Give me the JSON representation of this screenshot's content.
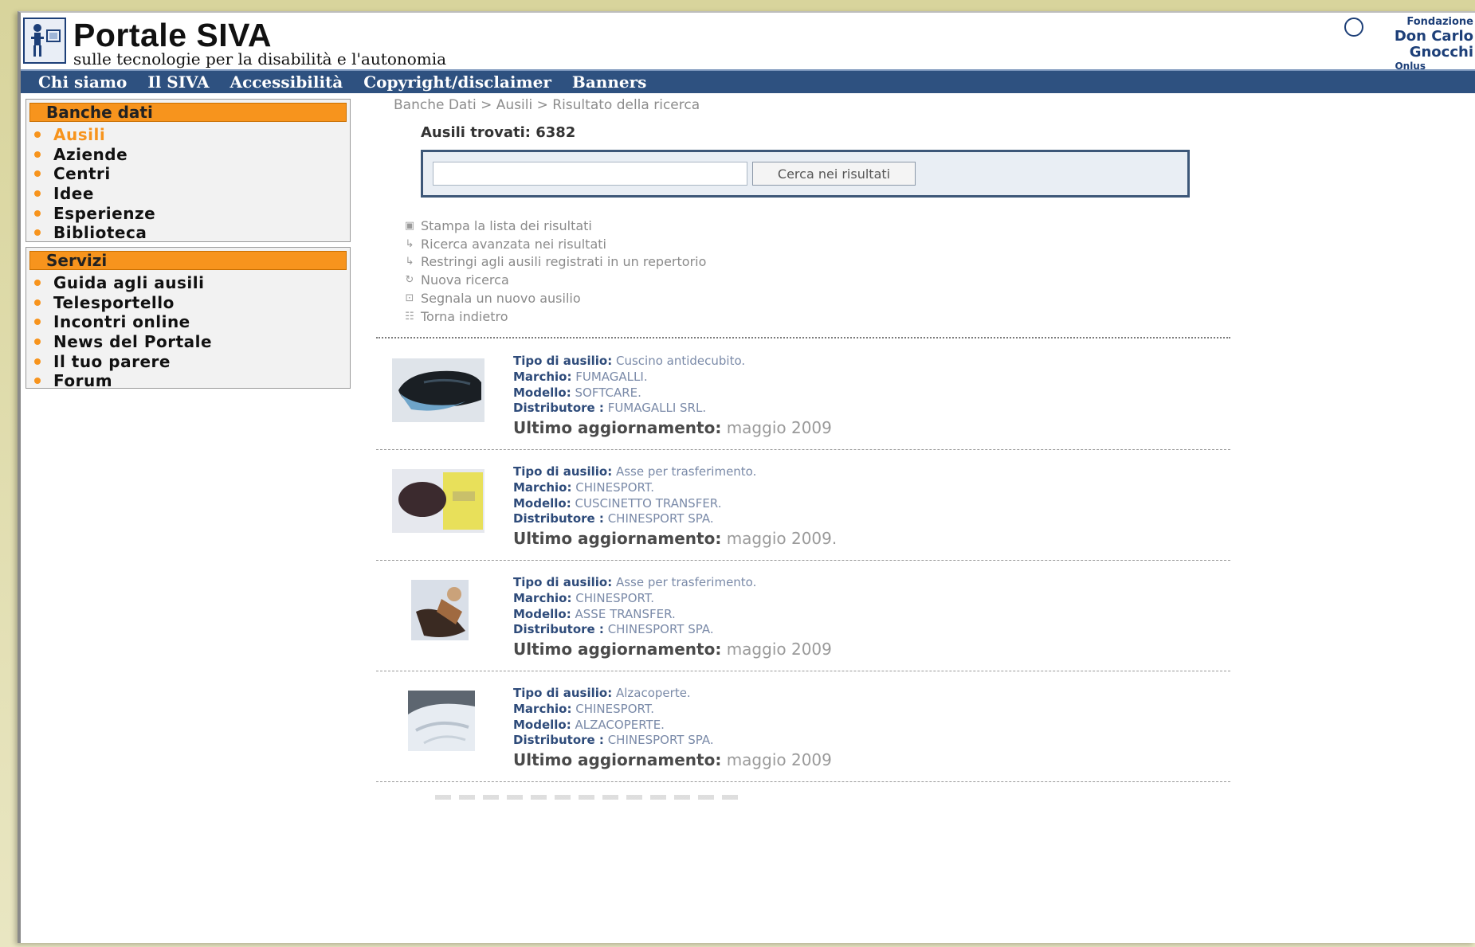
{
  "header": {
    "title": "Portale SIVA",
    "subtitle": "sulle tecnologie per la disabilità e l'autonomia",
    "partner_line1": "Fondazione",
    "partner_line2": "Don Carlo Gnocchi",
    "partner_line3": "Onlus"
  },
  "nav": [
    "Chi siamo",
    "Il SIVA",
    "Accessibilità",
    "Copyright/disclaimer",
    "Banners"
  ],
  "sidebar": {
    "databases": {
      "title": "Banche dati",
      "items": [
        "Ausili",
        "Aziende",
        "Centri",
        "Idee",
        "Esperienze",
        "Biblioteca"
      ],
      "active": "Ausili"
    },
    "services": {
      "title": "Servizi",
      "items": [
        "Guida agli ausili",
        "Telesportello",
        "Incontri online",
        "News del Portale",
        "Il tuo parere",
        "Forum"
      ]
    }
  },
  "main": {
    "breadcrumb": "Banche Dati > Ausili > Risultato della ricerca",
    "found_label": "Ausili trovati: 6382",
    "search": {
      "value": "",
      "button": "Cerca nei risultati"
    },
    "actions": [
      {
        "icon": "print-icon",
        "label": "Stampa la lista dei risultati"
      },
      {
        "icon": "search-icon",
        "label": "Ricerca avanzata nei risultati"
      },
      {
        "icon": "filter-icon",
        "label": "Restringi agli ausili registrati in un repertorio"
      },
      {
        "icon": "new-search-icon",
        "label": "Nuova ricerca"
      },
      {
        "icon": "report-icon",
        "label": "Segnala un nuovo ausilio"
      },
      {
        "icon": "back-icon",
        "label": "Torna indietro"
      }
    ],
    "labels": {
      "type": "Tipo di ausilio:",
      "brand": "Marchio:",
      "model": "Modello:",
      "distributor": "Distributore :",
      "updated": "Ultimo aggiornamento:"
    },
    "results": [
      {
        "type": "Cuscino antidecubito.",
        "brand": "FUMAGALLI.",
        "model": "SOFTCARE.",
        "distributor": "FUMAGALLI SRL.",
        "updated": "maggio 2009"
      },
      {
        "type": "Asse per trasferimento.",
        "brand": "CHINESPORT.",
        "model": "CUSCINETTO TRANSFER.",
        "distributor": "CHINESPORT SPA.",
        "updated": "maggio 2009."
      },
      {
        "type": "Asse per trasferimento.",
        "brand": "CHINESPORT.",
        "model": "ASSE TRANSFER.",
        "distributor": "CHINESPORT SPA.",
        "updated": "maggio 2009"
      },
      {
        "type": "Alzacoperte.",
        "brand": "CHINESPORT.",
        "model": "ALZACOPERTE.",
        "distributor": "CHINESPORT SPA.",
        "updated": "maggio 2009"
      }
    ]
  },
  "colors": {
    "nav_bg": "#2e5180",
    "accent_orange": "#f7941d",
    "label_blue": "#2e4b7a"
  }
}
